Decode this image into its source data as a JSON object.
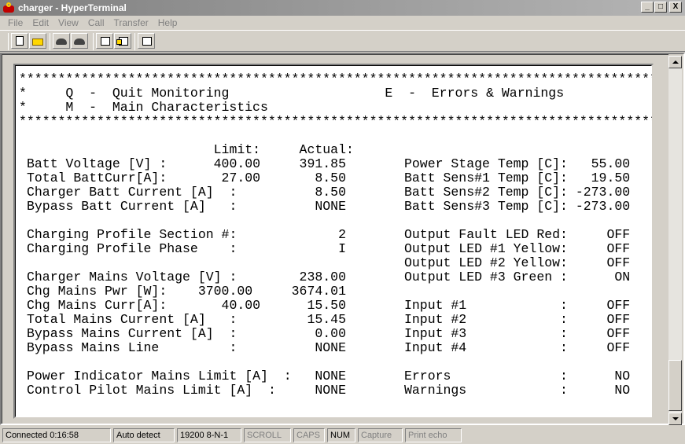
{
  "window": {
    "title": "charger - HyperTerminal",
    "buttons": {
      "minimize": "_",
      "maximize": "□",
      "close": "X"
    }
  },
  "menu": [
    "File",
    "Edit",
    "View",
    "Call",
    "Transfer",
    "Help"
  ],
  "toolbar": {
    "icons": [
      "new-document-icon",
      "open-folder-icon",
      "phone-icon",
      "disconnect-icon",
      "send-file-icon",
      "receive-file-icon",
      "properties-icon"
    ]
  },
  "terminal": {
    "header": {
      "border": "***************************************************************************************",
      "line1": "*     Q  -  Quit Monitoring                    E  -  Errors & Warnings                    *",
      "line2": "*     M  -  Main Characteristics                                                          *",
      "border2": "***************************************************************************************"
    },
    "heading": "                        Limit:     Actual:",
    "rows": [
      {
        "left": "Batt Voltage [V] :      400.00     391.85",
        "right": "Power Stage Temp [C]:   55.00"
      },
      {
        "left": "Total BattCurr[A]:       27.00       8.50",
        "right": "Batt Sens#1 Temp [C]:   19.50"
      },
      {
        "left": "Charger Batt Current [A]  :          8.50",
        "right": "Batt Sens#2 Temp [C]: -273.00"
      },
      {
        "left": "Bypass Batt Current [A]   :          NONE",
        "right": "Batt Sens#3 Temp [C]: -273.00"
      },
      {
        "left": "",
        "right": ""
      },
      {
        "left": "Charging Profile Section #:             2",
        "right": "Output Fault LED Red:     OFF"
      },
      {
        "left": "Charging Profile Phase    :             I",
        "right": "Output LED #1 Yellow:     OFF"
      },
      {
        "left": "",
        "right": "Output LED #2 Yellow:     OFF"
      },
      {
        "left": "Charger Mains Voltage [V] :        238.00",
        "right": "Output LED #3 Green :      ON"
      },
      {
        "left": "Chg Mains Pwr [W]:    3700.00     3674.01",
        "right": ""
      },
      {
        "left": "Chg Mains Curr[A]:       40.00      15.50",
        "right": "Input #1            :     OFF"
      },
      {
        "left": "Total Mains Current [A]   :         15.45",
        "right": "Input #2            :     OFF"
      },
      {
        "left": "Bypass Mains Current [A]  :          0.00",
        "right": "Input #3            :     OFF"
      },
      {
        "left": "Bypass Mains Line         :          NONE",
        "right": "Input #4            :     OFF"
      },
      {
        "left": "",
        "right": ""
      },
      {
        "left": "Power Indicator Mains Limit [A]  :   NONE",
        "right": "Errors              :      NO"
      },
      {
        "left": "Control Pilot Mains Limit [A]  :     NONE",
        "right": "Warnings            :      NO"
      }
    ]
  },
  "statusbar": {
    "connected": "Connected 0:16:58",
    "detect": "Auto detect",
    "settings": "19200 8-N-1",
    "scroll": "SCROLL",
    "caps": "CAPS",
    "num": "NUM",
    "capture": "Capture",
    "print_echo": "Print echo"
  }
}
